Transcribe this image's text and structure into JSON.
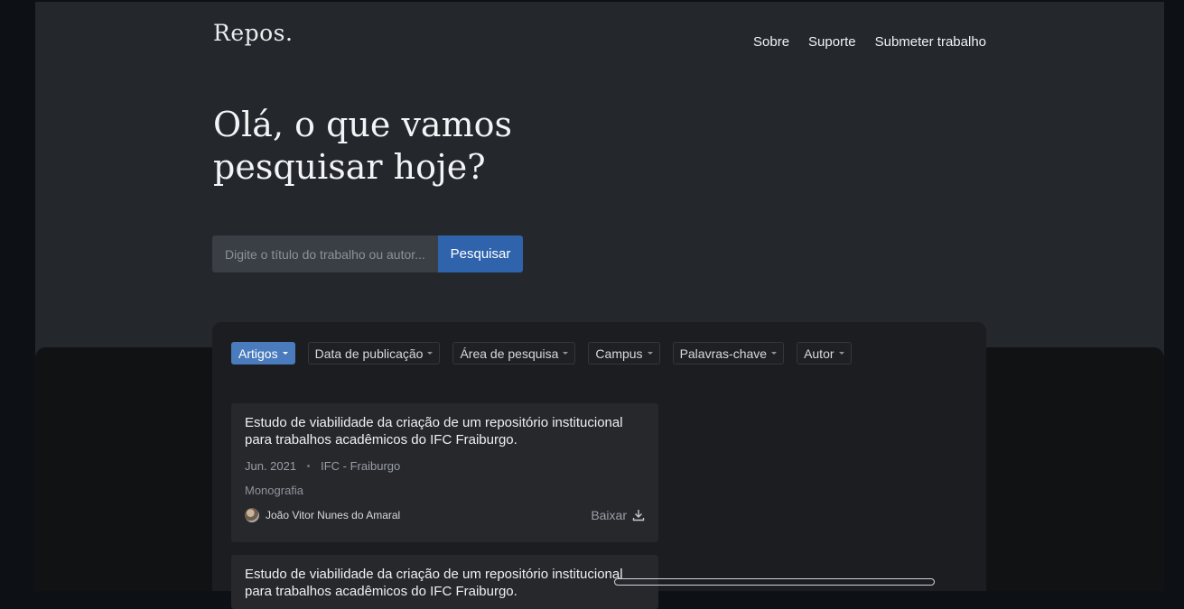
{
  "brand": "Repos.",
  "nav": {
    "items": [
      {
        "label": "Sobre"
      },
      {
        "label": "Suporte"
      },
      {
        "label": "Submeter trabalho"
      }
    ]
  },
  "hero": {
    "line1": "Olá, o que vamos",
    "line2": "pesquisar hoje?"
  },
  "search": {
    "placeholder": "Digite o título do trabalho ou autor...",
    "button_label": "Pesquisar"
  },
  "filters": [
    {
      "label": "Artigos",
      "active": true
    },
    {
      "label": "Data de publicação",
      "active": false
    },
    {
      "label": "Área de pesquisa",
      "active": false
    },
    {
      "label": "Campus",
      "active": false
    },
    {
      "label": "Palavras-chave",
      "active": false
    },
    {
      "label": "Autor",
      "active": false
    }
  ],
  "results": [
    {
      "title": "Estudo de viabilidade da criação de um repositório institucional para trabalhos acadêmicos do IFC Fraiburgo.",
      "date": "Jun. 2021",
      "campus": "IFC - Fraiburgo",
      "type": "Monografia",
      "author": "João Vitor Nunes do Amaral",
      "download_label": "Baixar"
    },
    {
      "title": "Estudo de viabilidade da criação de um repositório institucional para trabalhos acadêmicos do IFC Fraiburgo."
    }
  ],
  "colors": {
    "accent": "#2f64ad",
    "chip_active": "#4a7bbd",
    "background": "#24272c",
    "panel": "#1c1d20",
    "card": "#26282c"
  }
}
